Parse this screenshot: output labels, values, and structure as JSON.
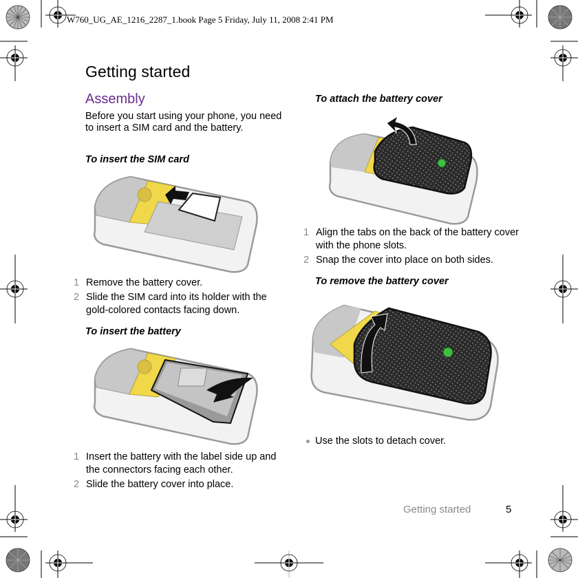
{
  "print_header": "W760_UG_AE_1216_2287_1.book  Page 5  Friday, July 11, 2008  2:41 PM",
  "page": {
    "title": "Getting started",
    "section": {
      "title": "Assembly",
      "intro": "Before you start using your phone, you need to insert a SIM card and the battery.",
      "colors": {
        "section_title": "#6b2b8f",
        "step_number": "#8a8a8a"
      }
    },
    "left_column": {
      "sim": {
        "heading": "To insert the SIM card",
        "illustration": "phone-insert-sim-card-illustration",
        "steps": [
          {
            "num": "1",
            "text": "Remove the battery cover."
          },
          {
            "num": "2",
            "text": "Slide the SIM card into its holder with the gold-colored contacts facing down."
          }
        ]
      },
      "battery": {
        "heading": "To insert the battery",
        "illustration": "phone-insert-battery-illustration",
        "steps": [
          {
            "num": "1",
            "text": "Insert the battery with the label side up and the connectors facing each other."
          },
          {
            "num": "2",
            "text": "Slide the battery cover into place."
          }
        ]
      }
    },
    "right_column": {
      "attach": {
        "heading": "To attach the battery cover",
        "illustration": "phone-attach-cover-illustration",
        "steps": [
          {
            "num": "1",
            "text": "Align the tabs on the back of the battery cover with the phone slots."
          },
          {
            "num": "2",
            "text": "Snap the cover into place on both sides."
          }
        ]
      },
      "remove": {
        "heading": "To remove the battery cover",
        "illustration": "phone-remove-cover-illustration",
        "bullets": [
          {
            "text": "Use the slots to detach cover."
          }
        ]
      }
    },
    "footer": {
      "section": "Getting started",
      "page_number": "5"
    }
  }
}
